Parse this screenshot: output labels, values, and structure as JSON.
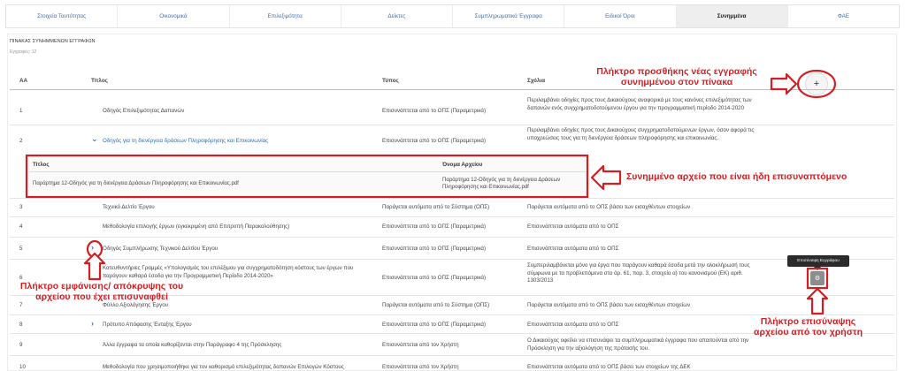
{
  "tabs": [
    {
      "label": "Στοιχεία Ταυτότητας",
      "active": false
    },
    {
      "label": "Οικονομικά",
      "active": false
    },
    {
      "label": "Επιλεξιμότητα",
      "active": false
    },
    {
      "label": "Δείκτες",
      "active": false
    },
    {
      "label": "Συμπληρωματικά Έγγραφα",
      "active": false
    },
    {
      "label": "Ειδικοί Όροι",
      "active": false
    },
    {
      "label": "Συνημμένα",
      "active": true
    },
    {
      "label": "ΦΑΕ",
      "active": false
    }
  ],
  "section": {
    "title": "ΠΙΝΑΚΑΣ ΣΥΝΗΜΜΕΝΩΝ ΕΓΓΡΑΦΩΝ",
    "records": "Εγγραφές: 12"
  },
  "table": {
    "headers": {
      "aa": "ΑΑ",
      "title": "Τίτλος",
      "type": "Τύπος",
      "comments": "Σχόλια"
    },
    "add_button_label": "+",
    "rows": [
      {
        "num": "1",
        "title": "Οδηγός Επιλεξιμότητας Δαπανών",
        "type": "Επισυνάπτεται από το ΟΠΣ (Παραμετρικά)",
        "comment": "Περιλαμβάνει οδηγίες προς τους Δικαιούχους αναφορικά με τους κανόνες επιλεξιμότητας των δαπανών ενός συγχρηματοδοτούμενου έργου για την προγραμματική περίοδο 2014-2020"
      },
      {
        "num": "2",
        "title": "Οδηγός για τη διενέργεια δράσεων Πληροφόρησης και Επικοινωνίας",
        "type": "Επισυνάπτεται από το ΟΠΣ (Παραμετρικά)",
        "comment": "Περιλαμβάνει οδηγίες προς τους Δικαιούχους συγχρηματοδοτούμενων έργων, όσον αφορά τις υποχρεώσεις τους για τη διενέργεια δράσεων πληροφόρησης και επικοινωνίας."
      },
      {
        "num": "3",
        "title": "Τεχνικό Δελτίο Έργου",
        "type": "Παράγεται αυτόματα από το Σύστημα (ΟΠΣ)",
        "comment": "Παράγεται αυτόματα από το ΟΠΣ βάσει των εισαχθέντων στοιχείων"
      },
      {
        "num": "4",
        "title": "Μεθοδολογία επιλογής έργων (εγκεκριμένη από Επιτροπή Παρακολούθησης)",
        "type": "Επισυνάπτεται από το ΟΠΣ (Παραμετρικά)",
        "comment": "Επισυνάπτεται αυτόματα από το ΟΠΣ"
      },
      {
        "num": "5",
        "title": "Οδηγός Συμπλήρωσης Τεχνικού Δελτίου Έργου",
        "type": "Επισυνάπτεται από το ΟΠΣ (Παραμετρικά)",
        "comment": "Επισυνάπτεται αυτόματα από το ΟΠΣ"
      },
      {
        "num": "6",
        "title": "Κατευθυντήριες Γραμμές «Υπολογισμός του επιλέξιμου για συγχρηματοδότηση κόστους των έργων που παράγουν καθαρά έσοδα για την Προγραμματική Περίοδο 2014-2020»",
        "type": "Επισυνάπτεται από το ΟΠΣ (Παραμετρικά)",
        "comment": "Συμπεριλαμβάνεται μόνο για έργα που παράγουν καθαρά έσοδα μετά την ολοκλήρωσή τους σύμφωνα με τα προβλεπόμενα στο άρ. 61, παρ. 3, στοιχείο α) του κανονισμού (ΕΚ) αριθ. 1303/2013"
      },
      {
        "num": "7",
        "title": "Φύλλο Αξιολόγησης Έργου",
        "type": "Παράγεται αυτόματα από το Σύστημα (ΟΠΣ)",
        "comment": "Παράγεται αυτόματα από το ΟΠΣ βάσει των εισαχθέντων στοιχείων"
      },
      {
        "num": "8",
        "title": "Πρότυπο Απόφασης Ένταξης Έργου",
        "type": "Επισυνάπτεται από το ΟΠΣ (Παραμετρικά)",
        "comment": "Επισυνάπτεται αυτόματα από το ΟΠΣ"
      },
      {
        "num": "9",
        "title": "Άλλα έγγραφα τα οποία καθορίζονται στην Παράγραφο 4 της Πρόσκλησης",
        "type": "Επισυνάπτεται από τον Χρήστη",
        "comment": "Ο Δικαιούχος οφείλει να επισυνάψει τα συμπληρωματικά έγγραφα που απαιτούνται από την Πρόσκληση για την αξιολόγηση της πρότασής του."
      },
      {
        "num": "10",
        "title": "Μεθοδολογία που χρησιμοποιήθηκε για τον καθορισμό επιλεξιμότητας δαπανών Επιλογών Κόστους",
        "type": "Επισυνάπτεται από τον Χρήστη",
        "comment": "Επισυνάπτεται αυτόματα από το ΟΠΣ βάσει των στοιχείων της ΔΕΚ"
      }
    ]
  },
  "subtable": {
    "headers": {
      "title": "Τίτλος",
      "filename": "Όνομα Αρχείου"
    },
    "title": "Παράρτημα 12-Οδηγός για τη διενέργεια Δράσεων Πληροφόρησης και Επικοινωνίας.pdf",
    "filename": "Παράρτημα 12-Οδηγός για τη διενέργεια Δράσεων Πληροφόρησης και Επικοινωνίας.pdf"
  },
  "attach": {
    "tooltip": "Επισύναψη Εγγράφου",
    "icon": "gear-icon"
  },
  "annotations": {
    "add_row": "Πλήκτρο προσθήκης νέας εγγραφής συνημμένου στον πίνακα",
    "attached_file": "Συνημμένο αρχείο που είναι ήδη επισυναπτόμενο",
    "toggle": "Πλήκτρο εμφάνισης/ απόκρυψης του αρχείου που έχει επισυναφθεί",
    "user_attach": "Πλήκτρο επισύναψης αρχείου από τον χρήστη"
  },
  "colors": {
    "accent": "#3f71b1",
    "annotation": "#d21f24"
  }
}
